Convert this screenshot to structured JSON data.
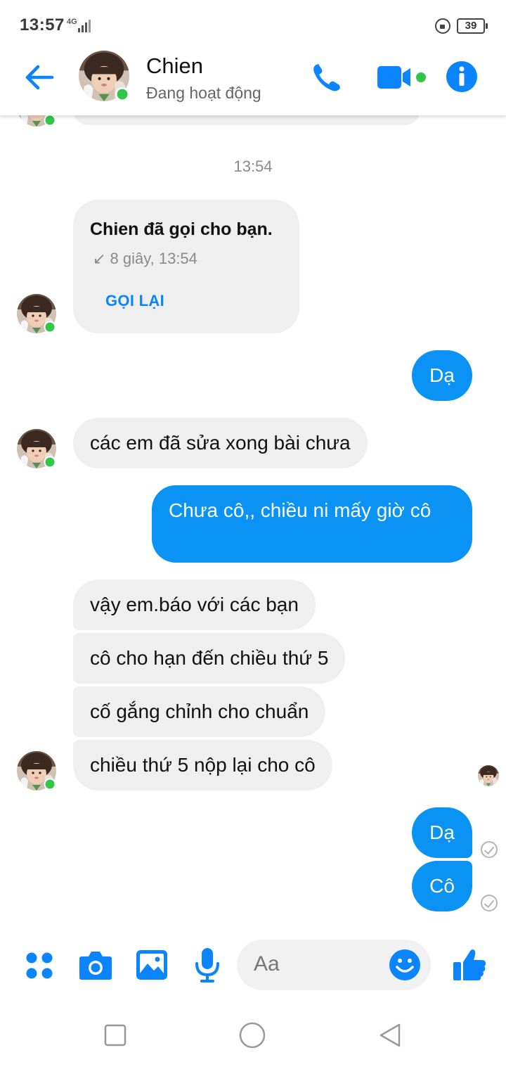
{
  "status_bar": {
    "time": "13:57",
    "network": "4G",
    "battery": "39"
  },
  "header": {
    "contact_name": "Chien",
    "contact_status": "Đang hoạt động"
  },
  "chat": {
    "timestamp": "13:54",
    "call_card": {
      "title": "Chien đã gọi cho bạn.",
      "meta": "↙ 8 giây, 13:54",
      "callback_label": "GỌI LẠI"
    },
    "messages": [
      "Dạ",
      "các em đã sửa xong bài chưa",
      "Chưa cô,, chiều ni mấy giờ cô",
      "vậy em.báo với các bạn",
      "cô cho hạn đến chiều thứ 5",
      "cố gắng chỉnh cho chuẩn",
      "chiều thứ 5 nộp lại cho cô",
      "Dạ",
      "Cô"
    ]
  },
  "composer": {
    "placeholder": "Aa"
  },
  "colors": {
    "accent": "#0a84ff",
    "outgoing_bubble": "#0a93f5",
    "incoming_bubble": "#efefef",
    "online_dot": "#31c54a"
  },
  "icons": {
    "back": "arrow-left-icon",
    "call": "phone-icon",
    "video": "video-camera-icon",
    "info": "info-icon",
    "more": "four-dots-icon",
    "camera": "camera-icon",
    "gallery": "image-icon",
    "mic": "microphone-icon",
    "emoji": "smiley-icon",
    "like": "thumbs-up-icon"
  }
}
